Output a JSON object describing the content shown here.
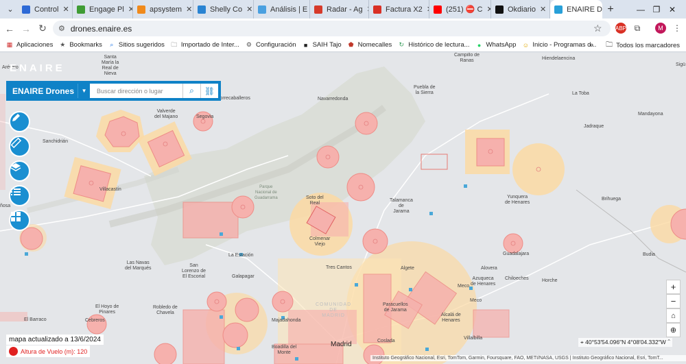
{
  "browser": {
    "tabs": [
      {
        "label": "Control",
        "color": "#2e6ad6"
      },
      {
        "label": "Engage Pl",
        "color": "#3f9c35"
      },
      {
        "label": "apsystem",
        "color": "#f08a1c"
      },
      {
        "label": "Shelly Co",
        "color": "#2a84d2"
      },
      {
        "label": "Análisis | E",
        "color": "#4aa0e0"
      },
      {
        "label": "Radar - Ag",
        "color": "#d63a2a"
      },
      {
        "label": "Factura X2",
        "color": "#d93025"
      },
      {
        "label": "(251) ⛔ C",
        "color": "#ff0000"
      },
      {
        "label": "Okdiario",
        "color": "#111111"
      },
      {
        "label": "ENAIRE D",
        "color": "#28a0d8"
      }
    ],
    "url": "drones.enaire.es",
    "bookmarks": [
      {
        "label": "Aplicaciones",
        "icon": "apps-grid-icon"
      },
      {
        "label": "Bookmarks",
        "icon": "star-icon"
      },
      {
        "label": "Sitios sugeridos",
        "icon": "search-icon"
      },
      {
        "label": "Importado de Inter...",
        "icon": "folder-icon"
      },
      {
        "label": "Configuración",
        "icon": "gear-icon"
      },
      {
        "label": "SAIH Tajo",
        "icon": "saih-icon"
      },
      {
        "label": "Nomecalles",
        "icon": "shield-icon"
      },
      {
        "label": "Histórico de lectura...",
        "icon": "refresh-icon"
      },
      {
        "label": "WhatsApp",
        "icon": "whatsapp-icon"
      },
      {
        "label": "Inicio - Programas d...",
        "icon": "smile-icon"
      }
    ],
    "bookmarks_more": "»",
    "all_bookmarks": "Todos los marcadores"
  },
  "app": {
    "logo": "ENAIRE",
    "brand": "ENAIRE Drones",
    "search_placeholder": "Buscar dirección o lugar",
    "updated": "mapa actualizado a  13/6/2024",
    "altitude": "Altura de Vuelo (m): 120",
    "coords": "40°53′54.096″N 4°08′04.332″W",
    "attribution": "Instituto Geográfico Nacional, Esri, TomTom, Garmin, Foursquare, FAO, METI/NASA, USGS | Instituto Geográfico Nacional, Esri, TomT...",
    "accent": "#0f82c7"
  },
  "map_labels": {
    "arevalo": "Arévalo",
    "santa_maria": "Santa\nMaría la\nReal de\nNieva",
    "campillo": "Campillo de\nRanas",
    "hiendelaencina": "Hiendelaencina",
    "sigu": "Sigü",
    "torrecaballeros": "Torrecaballeros",
    "navarredonda": "Navarredonda",
    "puebla": "Puebla de\nla Sierra",
    "latoba": "La Toba",
    "valverde": "Valverde\ndel Majano",
    "segovia": "Segovia",
    "mandayona": "Mandayona",
    "jadraque": "Jadraque",
    "sanchidrian": "Sanchidrián",
    "villacastin": "Villacastín",
    "parque": "Parque\nNacional de\nGuadarrama",
    "soto": "Soto del\nReal",
    "talamanca": "Talamanca\nde\nJarama",
    "yunquera": "Yunquera\nde Henares",
    "brihuega": "Brihuega",
    "penosa": "ñosa",
    "colmenar": "Colmenar\nViejo",
    "laestacion": "La Estación",
    "guadalajara": "Guadalajara",
    "budia": "Budia",
    "lasnavas": "Las Navas\ndel Marqués",
    "sanlorenzo": "San\nLorenzo de\nEl Escorial",
    "galapagar": "Galapagar",
    "trescantos": "Tres Cantos",
    "algete": "Algete",
    "alovera": "Alovera",
    "azuqueca": "Azuqueca\nde Henares",
    "chiloeches": "Chiloeches",
    "horche": "Horche",
    "meco": "Meco",
    "robledo": "Robledo de\nChavela",
    "elhoyo": "El Hoyo de\nPinares",
    "comunidad": "COMUNIDAD\nDE\nMADRID",
    "paracuellos": "Paracuellos\nde Jarama",
    "alcala": "Alcalá de\nHenares",
    "elbarraco": "El Barraco",
    "cebreros": "Cebreros",
    "majadahonda": "Majadahonda",
    "madrid": "Madrid",
    "coslada": "Coslada",
    "villalbilla": "Villalbilla",
    "boadilla": "Boadilla del\nMonte"
  }
}
